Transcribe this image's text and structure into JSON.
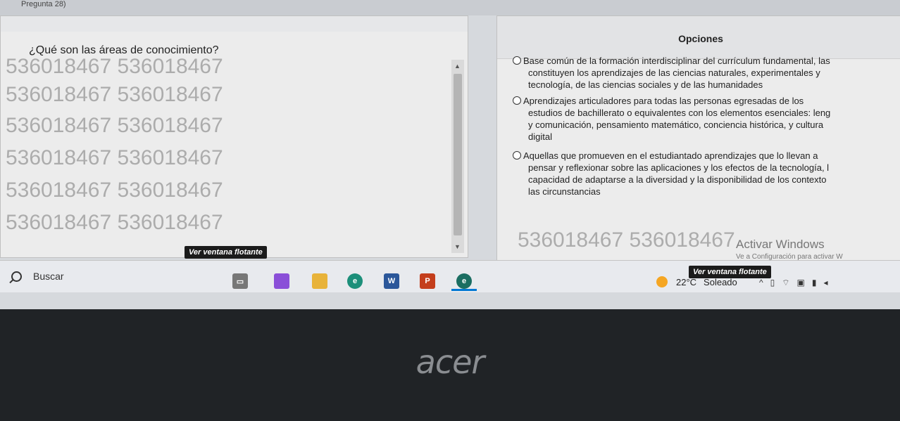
{
  "window": {
    "title": "Pregunta 28)"
  },
  "question": {
    "text": "¿Qué son las áreas de conocimiento?"
  },
  "options": {
    "title": "Opciones",
    "items": [
      {
        "line1": "Base común de la formación interdisciplinar del currículum fundamental, las",
        "line2": "constituyen los aprendizajes de las ciencias naturales, experimentales y",
        "line3": "tecnología, de las ciencias sociales y de las humanidades"
      },
      {
        "line1": "Aprendizajes articuladores para todas las personas egresadas de los",
        "line2": "estudios de bachillerato o equivalentes con los elementos esenciales: leng",
        "line3": "y comunicación, pensamiento matemático, conciencia histórica, y cultura",
        "line4": "digital"
      },
      {
        "line1": "Aquellas que promueven en el estudiantado aprendizajes que lo llevan a",
        "line2": "pensar y reflexionar sobre las aplicaciones y los efectos de la tecnología, l",
        "line3": "capacidad de adaptarse a la diversidad y la disponibilidad de los contexto",
        "line4": "las circunstancias"
      }
    ]
  },
  "watermark": {
    "text": "536018467"
  },
  "floating_buttons": {
    "left": "Ver ventana flotante",
    "right": "Ver ventana flotante"
  },
  "activation": {
    "title": "Activar Windows",
    "subtitle": "Ve a Configuración para activar W"
  },
  "taskbar": {
    "search_placeholder": "Buscar",
    "apps": [
      {
        "icon": "task-view-icon",
        "color": "#555555"
      },
      {
        "icon": "copilot-icon",
        "color": "#8a4fd8"
      },
      {
        "icon": "file-explorer-icon",
        "color": "#e8b33a"
      },
      {
        "icon": "edge-icon",
        "color": "#1c8f7a"
      },
      {
        "icon": "word-icon",
        "color": "#2b579a"
      },
      {
        "icon": "powerpoint-icon",
        "color": "#c43e1c"
      },
      {
        "icon": "browser-icon",
        "color": "#1b6e62"
      }
    ],
    "weather": {
      "temp": "22°C",
      "condition": "Soleado"
    }
  },
  "bezel": {
    "brand": "acer"
  }
}
